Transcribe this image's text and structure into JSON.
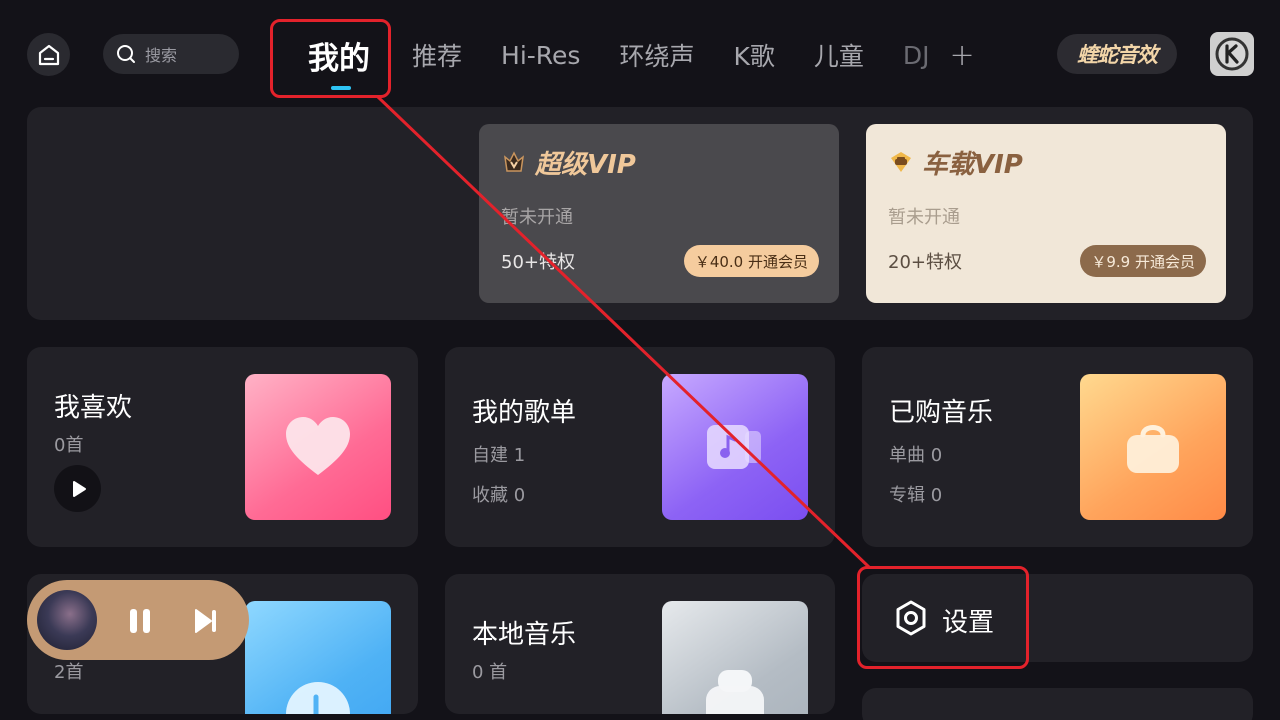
{
  "header": {
    "search_placeholder": "搜索",
    "tabs": [
      "我的",
      "推荐",
      "Hi-Res",
      "环绕声",
      "K歌",
      "儿童",
      "DJ"
    ],
    "plus": "+",
    "viper_label": "蝰蛇音效"
  },
  "vip": {
    "super": {
      "title": "超级VIP",
      "status": "暂未开通",
      "privileges": "50+特权",
      "button": "￥40.0 开通会员"
    },
    "car": {
      "title": "车载VIP",
      "status": "暂未开通",
      "privileges": "20+特权",
      "button": "￥9.9 开通会员"
    }
  },
  "cards": {
    "favorites": {
      "title": "我喜欢",
      "count": "0首"
    },
    "playlists": {
      "title": "我的歌单",
      "created": "自建 1",
      "collected": "收藏 0"
    },
    "purchased": {
      "title": "已购音乐",
      "singles": "单曲 0",
      "albums": "专辑 0"
    },
    "recent": {
      "count": "2首"
    },
    "local": {
      "title": "本地音乐",
      "count": "0 首"
    },
    "settings": {
      "title": "设置"
    }
  },
  "colors": {
    "background": "#131218",
    "card": "#222127",
    "accent": "#2ec4f5",
    "annotation": "#e3222b"
  }
}
